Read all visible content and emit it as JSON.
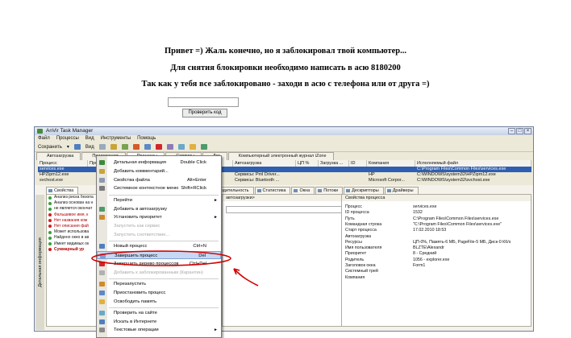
{
  "lock_screen": {
    "line1": "Привет =) Жаль конечно, но я заблокировал твой компьютер...",
    "line2": "Для снятия блокировки необходимо написать в асю 8180200",
    "line3": "Так как у тебя все заблокировано - заходи в асю с телефона или от друга =)",
    "input_value": "",
    "button_label": "Проверить код"
  },
  "app": {
    "title": "AnVir Task Manager",
    "menu": [
      "Файл",
      "Процессы",
      "Вид",
      "Инструменты",
      "Помощь"
    ],
    "toolbar": {
      "save_label": "Сохранить",
      "view_label": "Вид"
    },
    "top_tabs": [
      "Приложения",
      "Процессы",
      "Сервисы",
      "Лог",
      "Компьютерный электронный журнал iZone"
    ],
    "autorun_tab": "Автозагрузка",
    "columns": [
      "Процесс",
      "Продукт",
      "",
      "Уровень р...",
      "Автозагрузка",
      "ЦП %",
      "Загрузка ...",
      "ID",
      "Компания",
      "Исполняемый файл"
    ],
    "processes": [
      {
        "name": "services.exe",
        "autorun": "",
        "cpu": "",
        "id": "",
        "company": "",
        "path": "C:\\Program Files\\Common Files\\services.exe"
      },
      {
        "name": "HPZipm12.exe",
        "autorun": "Сервисы: Pml Driver...",
        "cpu": "",
        "id": "",
        "company": "HP",
        "path": "C:\\WINDOWS\\system32\\HPZipm12.exe"
      },
      {
        "name": "svchost.exe",
        "autorun": "Сервисы: Bluetooth ...",
        "cpu": "",
        "id": "",
        "company": "Microsoft Corpor...",
        "path": "C:\\WINDOWS\\system32\\svchost.exe"
      }
    ],
    "side_label": "Детальная информация",
    "bottom_tabs": [
      "Свойства",
      "Производительность",
      "Статистика",
      "Окна",
      "Потоки",
      "Дескрипторы",
      "Драйверы"
    ],
    "security_items": [
      {
        "text": "Анализ риска безопа",
        "warn": false
      },
      {
        "text": "Анализ основан на н",
        "warn": false
      },
      {
        "text": "не является окончат",
        "warn": false
      },
      {
        "text": "Фальшивое имя, к",
        "warn": true
      },
      {
        "text": "Нет названия ком",
        "warn": true
      },
      {
        "text": "Нет описания фай",
        "warn": true
      },
      {
        "text": "Может использова",
        "warn": false
      },
      {
        "text": "Найдено окно в ав",
        "warn": false
      },
      {
        "text": "Имеет видимых ок",
        "warn": false
      },
      {
        "text": "Суммарный ур",
        "warn": true
      }
    ],
    "autorun_field_label": "автозагрузки>",
    "properties_title": "Свойства процесса",
    "properties": [
      {
        "k": "Процесс",
        "v": "services.exe"
      },
      {
        "k": "ID процесса",
        "v": "1532"
      },
      {
        "k": "Путь",
        "v": "C:\\Program Files\\Common Files\\services.exe"
      },
      {
        "k": "Командная строка",
        "v": "\"C:\\Program Files\\Common Files\\services.exe\""
      },
      {
        "k": "Старт процесса",
        "v": "17.02.2010 18:53"
      },
      {
        "k": "Автозагрузка",
        "v": ""
      },
      {
        "k": "Ресурсы",
        "v": "ЦП-0%, Память-6 МБ, PageFile-5 МБ, Диск-0 Кб/s"
      },
      {
        "k": "Имя пользователя",
        "v": "BLZTE\\Alexandr"
      },
      {
        "k": "Приоритет",
        "v": "8 - Средний"
      },
      {
        "k": "Родитель",
        "v": "1056 - explorer.exe"
      },
      {
        "k": "Заголовок окна",
        "v": "Form1"
      },
      {
        "k": "Системный трей",
        "v": ""
      },
      {
        "k": "Компания",
        "v": ""
      }
    ]
  },
  "context_menu": {
    "items": [
      {
        "label": "Детальная информация",
        "shortcut": "Double Click",
        "icon": "check-icon"
      },
      {
        "label": "Добавить комментарий...",
        "shortcut": "",
        "icon": "comment-icon"
      },
      {
        "label": "Свойства файла",
        "shortcut": "Alt+Enter",
        "icon": "file-properties-icon"
      },
      {
        "label": "Системное контекстное меню",
        "shortcut": "Shift+RClick",
        "icon": "menu-icon"
      },
      {
        "label": "Перейти",
        "shortcut": "",
        "icon": "",
        "submenu": true
      },
      {
        "label": "Добавить в автозагрузку",
        "shortcut": "",
        "icon": "autorun-icon"
      },
      {
        "label": "Установить приоритет",
        "shortcut": "",
        "icon": "priority-icon",
        "submenu": true
      },
      {
        "label": "Запустить как сервис",
        "shortcut": "",
        "icon": "",
        "disabled": true
      },
      {
        "label": "Запустить соответствие...",
        "shortcut": "",
        "icon": "",
        "disabled": true
      },
      {
        "label": "Новый процесс",
        "shortcut": "Ctrl+N",
        "icon": "new-process-icon"
      },
      {
        "label": "Завершить процесс",
        "shortcut": "Del",
        "icon": "terminate-icon",
        "highlighted": true
      },
      {
        "label": "Завершить дерево процессов",
        "shortcut": "Ctrl+Del",
        "icon": "terminate-tree-icon"
      },
      {
        "label": "Добавить к заблокированным (Карантин)",
        "shortcut": "",
        "icon": "quarantine-icon",
        "disabled": true
      },
      {
        "label": "Перезапустить",
        "shortcut": "",
        "icon": "restart-icon"
      },
      {
        "label": "Приостановить процесс",
        "shortcut": "",
        "icon": "pause-icon"
      },
      {
        "label": "Освободить память",
        "shortcut": "",
        "icon": "memory-icon"
      },
      {
        "label": "Проверить на сайте",
        "shortcut": "",
        "icon": "web-check-icon"
      },
      {
        "label": "Искать в Интернете",
        "shortcut": "",
        "icon": "web-search-icon"
      },
      {
        "label": "Текстовые операции",
        "shortcut": "",
        "icon": "text-icon",
        "submenu": true
      }
    ]
  },
  "colors": {
    "annotation": "#d40000",
    "selection": "#2f5fb0",
    "highlight": "#c8d7f3"
  }
}
